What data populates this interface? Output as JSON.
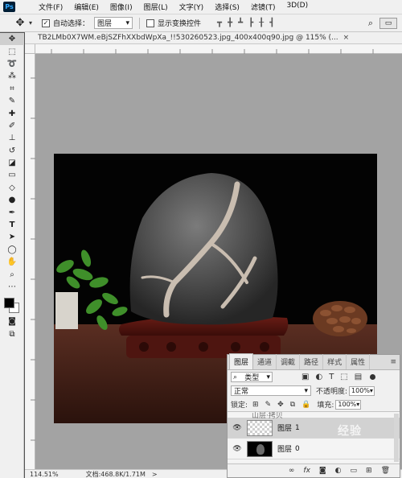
{
  "app": {
    "logo": "Ps"
  },
  "menu": [
    "文件(F)",
    "编辑(E)",
    "图像(I)",
    "图层(L)",
    "文字(Y)",
    "选择(S)",
    "滤镜(T)",
    "3D(D)"
  ],
  "options_bar": {
    "auto_select_label": "自动选择：",
    "auto_select_checked": true,
    "auto_select_target": "图层",
    "show_transform_label": "显示变换控件",
    "show_transform_checked": false
  },
  "document": {
    "tab_title": "TB2LMb0X7WM.eBjSZFhXXbdWpXa_!!530260523.jpg_400x400q90.jpg @ 115% (...",
    "tab_close": "×",
    "background_color": "#a3a3a3"
  },
  "status": {
    "zoom": "114.51%",
    "doc_size": "文档:468.8K/1.71M",
    "arrow": ">"
  },
  "layers_panel": {
    "tabs": [
      "图层",
      "通道",
      "调整",
      "路径",
      "样式",
      "属性"
    ],
    "active_tab": "图层",
    "tab_display": [
      "图层",
      "通道",
      "调截",
      "路径",
      "样式",
      "属性"
    ],
    "filter_kind": "类型",
    "blend_mode": "正常",
    "opacity_label": "不透明度:",
    "opacity_value": "100%",
    "lock_label": "锁定:",
    "fill_label": "填充:",
    "fill_value": "100%",
    "partial_layer_name": "山层·拷贝",
    "layers": [
      {
        "name": "图层",
        "num": "1",
        "selected": true,
        "visible": true
      },
      {
        "name": "图层",
        "num": "0",
        "selected": false,
        "visible": true
      }
    ]
  },
  "watermark": "经验"
}
